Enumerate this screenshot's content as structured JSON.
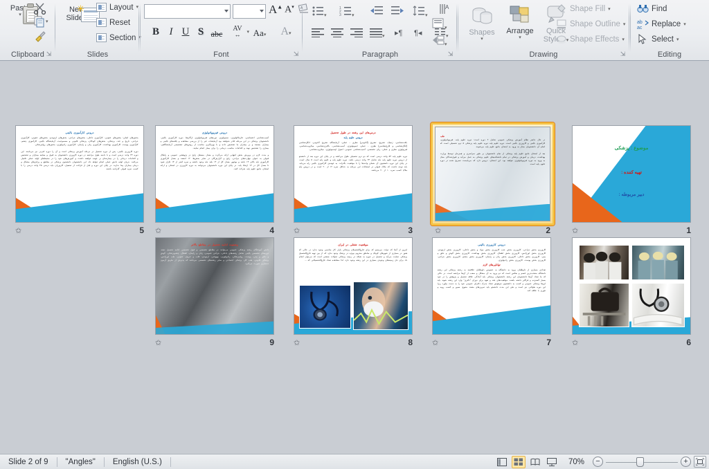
{
  "app": {
    "name": "Microsoft PowerPoint",
    "view": "Slide Sorter"
  },
  "ribbon": {
    "groups": [
      {
        "id": "clipboard",
        "label": "Clipboard"
      },
      {
        "id": "slides",
        "label": "Slides"
      },
      {
        "id": "font",
        "label": "Font"
      },
      {
        "id": "paragraph",
        "label": "Paragraph"
      },
      {
        "id": "drawing",
        "label": "Drawing"
      },
      {
        "id": "editing",
        "label": "Editing"
      }
    ],
    "clipboard": {
      "paste_label": "Paste",
      "cut_tooltip": "Cut",
      "copy_tooltip": "Copy",
      "format_painter_tooltip": "Format Painter"
    },
    "slides": {
      "new_slide_line1": "New",
      "new_slide_line2": "Slide",
      "layout_label": "Layout",
      "reset_label": "Reset",
      "section_label": "Section"
    },
    "font": {
      "font_name_value": "",
      "font_name_placeholder": "",
      "font_size_value": "",
      "font_size_placeholder": "",
      "grow_font": "A",
      "shrink_font": "A",
      "clear_formatting": "Clear Formatting",
      "bold": "B",
      "italic": "I",
      "underline": "U",
      "shadow": "S",
      "strikethrough": "abc",
      "character_spacing": "AV",
      "change_case": "Aa",
      "font_color": "A"
    },
    "paragraph": {
      "bullets": "Bullets",
      "numbering": "Numbering",
      "decrease_indent": "Decrease List Level",
      "increase_indent": "Increase List Level",
      "line_spacing": "Line Spacing",
      "align_left": "Align Text Left",
      "center": "Center",
      "align_right": "Align Text Right",
      "justify": "Justify",
      "ltr": "Left-to-Right",
      "rtl": "Right-to-Left",
      "columns": "Columns",
      "text_direction": "Text Direction",
      "align_text": "Align Text",
      "convert_smartart": "Convert to SmartArt"
    },
    "drawing": {
      "shapes_label": "Shapes",
      "arrange_label": "Arrange",
      "quick_styles_line1": "Quick",
      "quick_styles_line2": "Styles",
      "shape_fill": "Shape Fill",
      "shape_outline": "Shape Outline",
      "shape_effects": "Shape Effects"
    },
    "editing": {
      "find": "Find",
      "replace": "Replace",
      "select": "Select"
    }
  },
  "slides_panel": {
    "selected_slide": 2,
    "slides": [
      {
        "number": "5",
        "kind": "text",
        "title": "دروس کارآموزی بالینی",
        "title_color": "#1f6fb0",
        "body": "بخش‌های اصلی: بخش‌های عفونی، کارآموزی داخلی، بخش‌های جراحی، بخش‌های ارتوپدی، بخش‌های عفونی، کارآموزی جراحی، تاریخ و غدد، پزشکی، بخش‌های کودکان، پزشکی قانونی و مسموعیت، آزمایشگاه بالینی، کارآموزی چشم، کارآموزی پوست، کارآموزی بهداشت، کارآموزی زنان و زایمان، کارآموزی رادیولوژی، بخش‌های روانپزشکی.",
        "body2": "دوره کارورزی بالینی، پس از دوره تحصیل در مرحله آموزش پزشکی است و آن را دوره انترنی نیز می‌نامند. این دوره ۲۴ واحد درسی است و با دامنه طول مراجعه در دوره کارورزی دانشجویان به قبول و معاینه بیماران و تشخیص و اقدامات درمانی را در بیمارستان بر عهده خواهند داشت و آموزش‌های خود را در محیط‌های اولیه عملی تکمیل می‌کنند.",
        "highlight": "جریان اولیه دانش عملی انجام خواهد داد. این دانشجویان دانشجوی پزشکی در مقاطع و پرانتزهای مشکل و درمان بیماران پیدا ندارند. در پایان این دوره و قبل از فراغت از تحصیل، کارورزان باید درسی ۴۵ واحد درسی را با کسب نمره قبولی گذرانده باشند."
      },
      {
        "number": "4",
        "kind": "text",
        "title": "دروس فیزیوپاتولوژی",
        "title_color": "#1f6fb0",
        "body": "آسیب‌شناسی اختصاصی، فارماکولوژی، سمیولوژی دوره‌های فیزیوپاتولوژی ارگان‌ها، دوره کارآموزی بالینی. دانشجویان پزشکی در این مرحله قادر نخواهند بود آزمایشات غیر را از بررسی مشاهده و یافته‌های بالینی و بیماران بسنجد و بر بیماران ما تشخیص داده و با بهره‌گیری مناسب از روش‌های تشخیصی آزمایشگاهی، بیماری را تشخیص نهند و اقدامات مناسب درمانی را برای بیمار انجام نمایند.",
        "body2": "و مدت لازم در پرورش بخش انتهایی ارائه می‌گردد و معدل مستقل رایج در پژوهشی عمومی و راهکار قبولی به عنوان مهارت‌های جراحی، رایج و گزارش‌گان در سایر بخش‌ها.",
        "highlight": "۱۲ اسفند و معدل کارآموزی کارآموزی باید بالای ۱۴ باشد و بوشهر معدل کل از ۱۴ بلند باید وجود داشته و نمره کمتر از ۱۴ تکرار شود تا معدل کل در ۱۴ ارتقاء یابد. در پایان این دوره دانشجویان می‌توانند به دوره کارورزی در امتحان و ارائه امتحان جامع علوم پایه شرکت کنند."
      },
      {
        "number": "3",
        "kind": "text",
        "title": "درس‌های این رشته در طول تحصیل",
        "title_color": "#d01a16",
        "subtitle": "دروس علوم پایه",
        "subtitle_color": "#1f6fb0",
        "body": "بافت‌شناسی، ژنتیک، تشریح، تشریح (آناتومی) نظری - عملی، آزمایشگاه تشریح آناتومی، انگل‌شناسی (انگل‌شناسی و قارچ‌شناسی) نظری - عملی، ایمونولوژی، آسیب‌شناسی، باکتری‌شناسی، میکروب‌شناسی، فیزیولوژی نظری و عملی، زبان تخصصی، آسیب‌شناسی عمومی، اصول اپیدمیولوژی، میکروب‌شناسی.",
        "body2": "دوره علوم پایه ۵۴ واحد درسی است که دو ترم تحصیلی طول می‌کشد و در پایان این دوره بعد از دانشجو از دروس دوره علوم پایه باید شامل ۲۴ واحد درسی باشد.",
        "highlight": "دوره علوم پایه و علوم پایه است ۵ سال است. در پایان این دوره دانشجوی آن شمای واحدها را با موفقیت بگذراند. به عهده‌ی کارآموزی بالینی راه می‌یابد. باید توجه داشت که ملاک قبولی در امتحانات این مرحله به حداقل نمره ۱۲ از ۲۰ است و در دروس پایه ملاک کسب نمره ۱۰ از ۲۰ می‌باشد."
      },
      {
        "number": "2",
        "kind": "text-photo",
        "selected": true,
        "body": "در حال حاضر نظام آموزش پزشکی عمومی شامل ۲ دوره است: دوره علوم پایه، فیزیوپاتولوژی، کارآموزی بالینی و کارورزی بالینی است. دوره علوم پایه دوره علوم پایه پزشکی ۵ ترم تحصیلی است که اتمام آن دانشجویان مجاز به ورود به امتحان جامع علوم پایه می‌شوند.",
        "body2": "بعد از امتحان جامع علوم پایه پزشکی از تمام دانشجویان بر طور سراسری و همزمان توسط وزارت بهداشت، درمان و آموزش پزشکی در تمام دانشکده‌های علوم پزشکی به عمل می‌آید و قبول‌شدگان مجاز به ورود به دوره فیزیوپاتولوژی خواهند بود. این امتحان، دروس دارد که می‌بایست تصریح شده در دوره علوم پایه است."
      },
      {
        "number": "1",
        "kind": "title-slide",
        "lines": [
          {
            "text": "موضوع : پزشکی",
            "color": "#1f9d55"
          },
          {
            "text": "تهیه کننده :",
            "color": "#d01a16"
          },
          {
            "text": "دبیر مربوطه :",
            "color": "#1f4fa8"
          }
        ]
      },
      {
        "number": "9",
        "kind": "dark-text",
        "title": "وضعیت ادامه تحصیل در مقاطع بالاتر",
        "title_color": "#d01a16",
        "body": "دانش آموختگان رشته پزشکی عمومی می‌توانند در مقاطع تخصصی و فوق تخصصی ادامه تحصیل دهند. دوره‌های تخصصی بالینی شامل رشته‌های داخلی، جراحی عمومی، زنان و زایمان، اطفال، چشم‌پزشکی، گوش و حلق و بینی، پوست، روانپزشکی، رادیولوژی، بیهوشی، ارتوپدی، قلب و عروق، عفونی، طب اورژانس، پزشکی قانونی، طب کار، پزشکی اجتماعی و سایر رشته‌های تخصصی می‌باشد که پذیرش از طریق آزمون دستیاری صورت می‌گیرد."
      },
      {
        "number": "8",
        "kind": "text-photos",
        "title": "موقعیت شغلی در ایران",
        "title_color": "#d01a16",
        "body": "امروز از آنجا که دولت می‌بینیم که برای فارغ‌التحصیلان پزشکی بازار کار مناسبی وجود ندارد در حالی که هنوز در بسیاری از شهرهای کوچک و مناطق محروم بویژه در پزشک وجود ندارد که از بین تهیه فارغ‌التحصیل پزشکی حمایت می‌آید و تحصیل در حوزه به شبکه در زمینه پزشکی تحولات صنعتی است که می‌توان انجام داد برای حل زمینه‌های وجودی بسیاری در این رشته وجود دارد. لذا مشاهده تعداد فارغ‌التحصیلانی که ..."
      },
      {
        "number": "7",
        "kind": "text",
        "title": "دروس کارورزی بالینی",
        "title_color": "#1f6fb0",
        "body": "کارورزی بخش جراحی، کارورزی بخش جنب کارورزی بخش مواد و بخش داخلی، کارورزی بخش ارتوپدی، کارورزی بخش اورژانس، کارورزی بخش اطفال، کارورزی بخش بهداشت، کارورزی بخش گوش و حلق و بینی، کارورزی بخش داخلی، کارورزی بخش زنان و زایمان، کارورزی بخش چشم، کارورزی بخش جراحی، کارورزی بخش پوست، کارورزی بخش رادیولوژی.",
        "subtitle": "توانایی‌های لازم",
        "subtitle_color": "#d01a16",
        "body2": "تعدادی بسیاری از داوطلبان ورود به دانشگاه به خصوص داوطلبان علاقمند به رشته پزشکی این رشته دانشگاه منتخب‌ترین قسم و بعکس است که دو ورود به آن مشکل و صعب از آن‌ها مراجعه است. در حالی که ما تعداد آن‌ها دانشجویان این رشته دانشجویان پزشکی باید آمادگی علاقه تحصیل و پژوهش را در خود بسیار گسترده و فراگیر داشته باشند.",
        "highlight": "موفقیت‌های بلند و تعهد برای دوران \"دکتری\" وارد این رشته شوند باید این‌ها پزشکی عمومی و کسب به دانشجوی تیزهوش تعداد مدرک دکترای عمومی خود را به دست بیاورد زیرا این دوره طولانی نیز است و طی این مدت دانشجو باید تمرین‌های متعدد متنوع، صبور و کسب رویه و تئوری با علاقه کند."
      },
      {
        "number": "6",
        "kind": "photos-only",
        "caption": ""
      }
    ]
  },
  "status_bar": {
    "slide_indicator": "Slide 2 of 9",
    "theme": "\"Angles\"",
    "language": "English (U.S.)",
    "views": [
      {
        "name": "normal-view",
        "label": "Normal",
        "active": false
      },
      {
        "name": "slide-sorter-view",
        "label": "Slide Sorter",
        "active": true
      },
      {
        "name": "reading-view",
        "label": "Reading View",
        "active": false
      },
      {
        "name": "slide-show-view",
        "label": "Slide Show",
        "active": false
      }
    ],
    "zoom_level": "70%",
    "zoom_out": "−",
    "zoom_in": "+",
    "fit_to_window": "Fit slide to current window"
  },
  "colors": {
    "accent_blue": "#2aa8d8",
    "accent_orange": "#e8661b",
    "selection_gold": "#f5c244",
    "heading_red": "#d01a16",
    "heading_blue": "#1f6fb0",
    "panel_bg": "#c9cdd3"
  }
}
